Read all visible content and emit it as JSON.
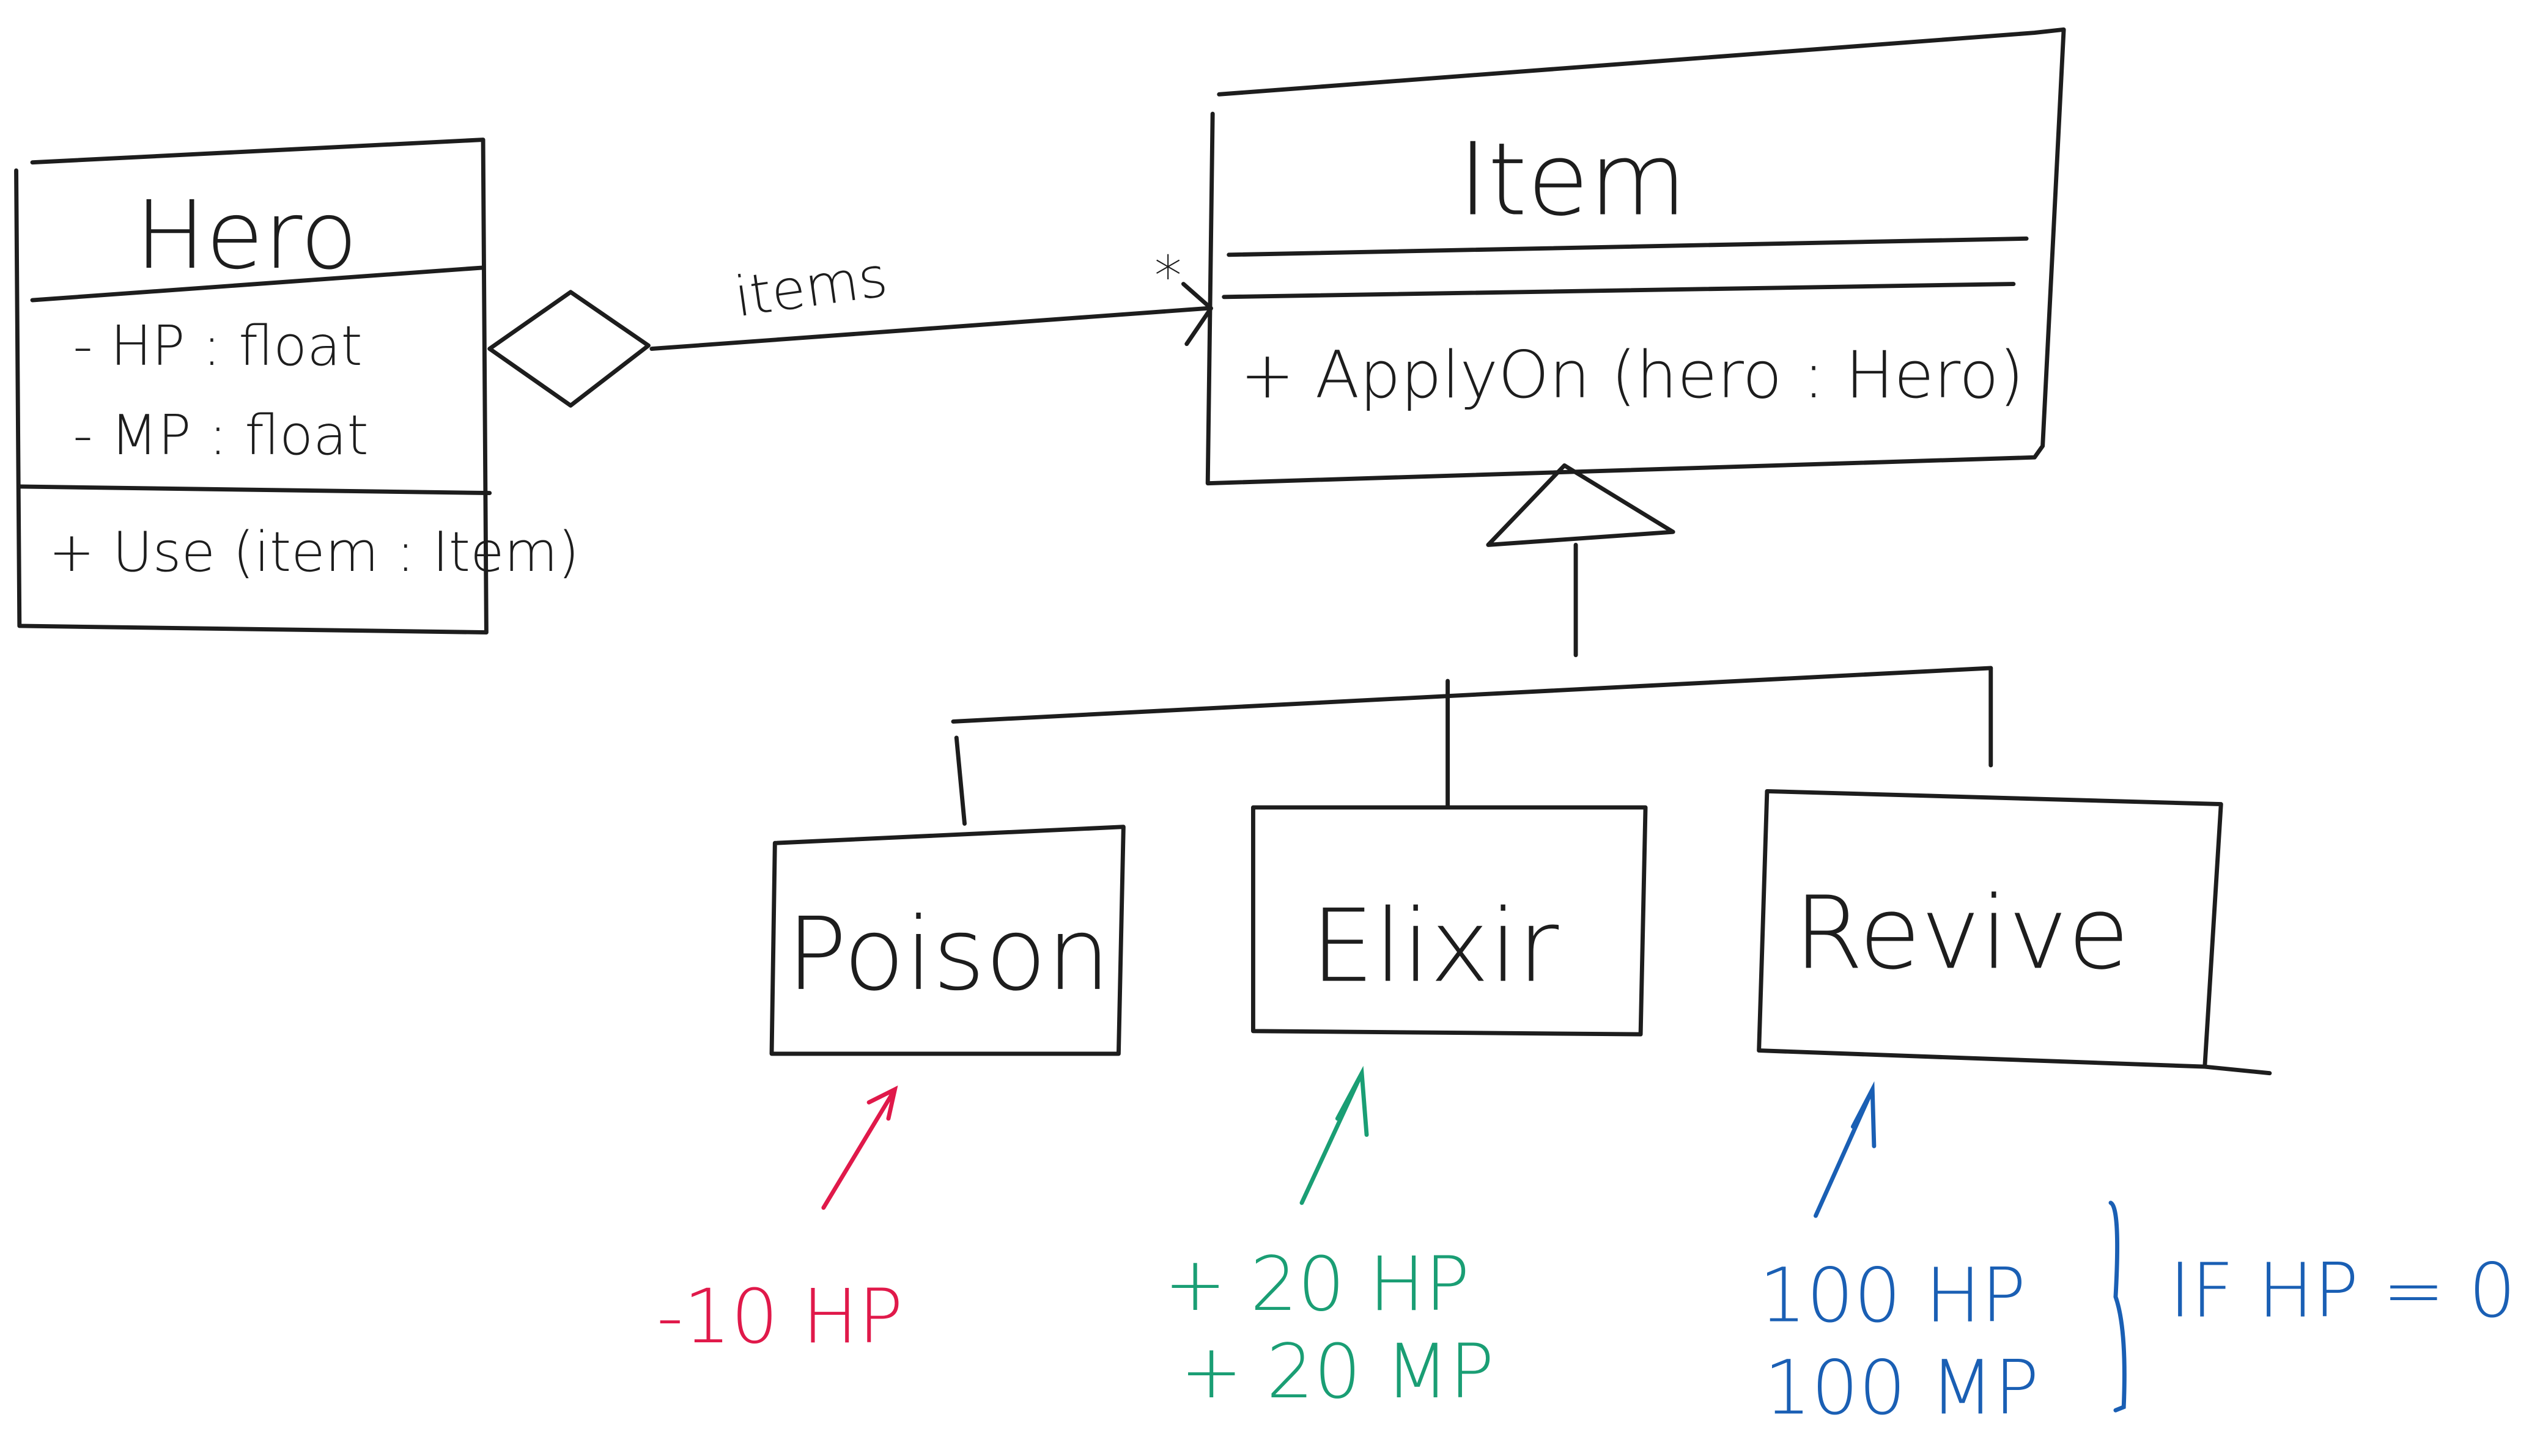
{
  "colors": {
    "ink": "#1d1d1d",
    "poison_note": "#e0194a",
    "elixir_note": "#1a9e74",
    "revive_note": "#1a5fb4"
  },
  "hero": {
    "name": "Hero",
    "attributes": [
      "- HP : float",
      "- MP : float"
    ],
    "methods": [
      "+ Use (item : Item)"
    ]
  },
  "association": {
    "label": "items",
    "multiplicity": "*"
  },
  "item": {
    "name": "Item",
    "methods": [
      "+ ApplyOn (hero : Hero)"
    ]
  },
  "subclasses": [
    {
      "name": "Poison",
      "notes": [
        "-10 HP"
      ]
    },
    {
      "name": "Elixir",
      "notes": [
        "+ 20 HP",
        "+ 20 MP"
      ]
    },
    {
      "name": "Revive",
      "notes": [
        "100 HP",
        "100 MP"
      ],
      "condition": "IF HP = 0"
    }
  ]
}
